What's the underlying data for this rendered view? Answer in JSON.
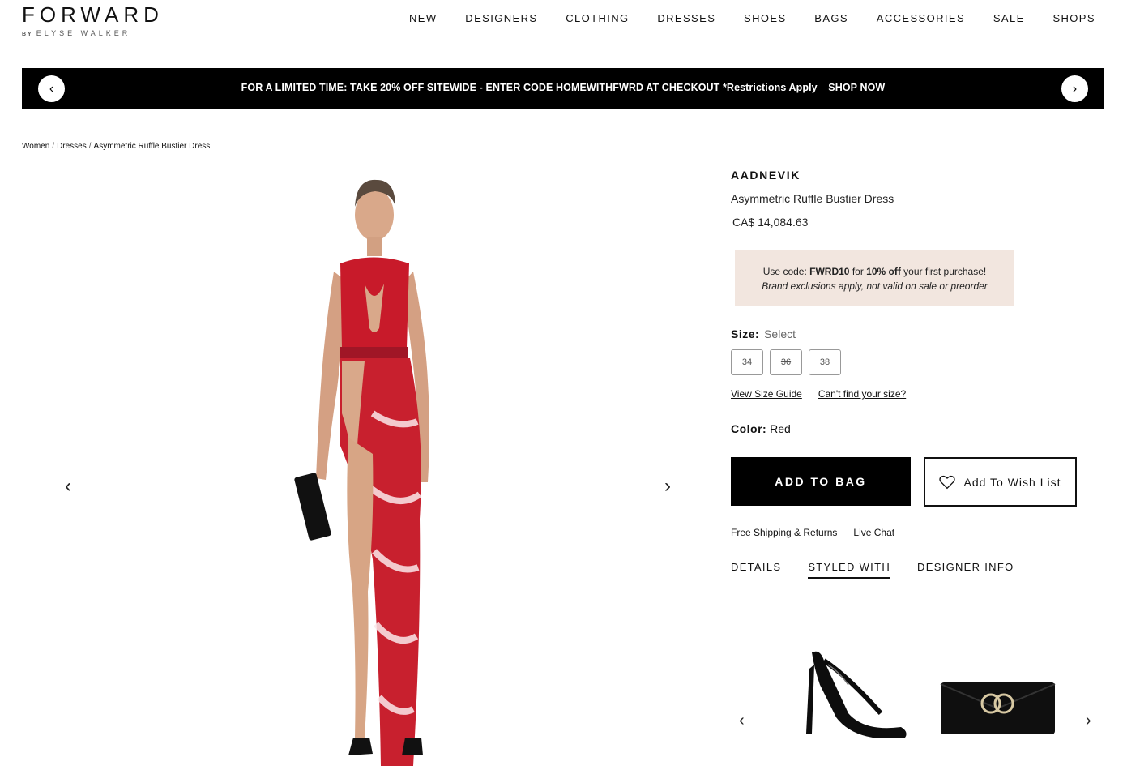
{
  "logo": {
    "main": "FORWARD",
    "by": "BY",
    "sub": "ELYSE WALKER"
  },
  "nav": [
    "NEW",
    "DESIGNERS",
    "CLOTHING",
    "DRESSES",
    "SHOES",
    "BAGS",
    "ACCESSORIES",
    "SALE",
    "SHOPS"
  ],
  "banner": {
    "text": "FOR A LIMITED TIME: TAKE 20% OFF SITEWIDE - ENTER CODE HOMEWITHFWRD AT CHECKOUT *Restrictions Apply",
    "cta": "SHOP NOW",
    "prev_icon": "chevron-left-icon",
    "next_icon": "chevron-right-icon"
  },
  "breadcrumb": [
    "Women",
    "Dresses",
    "Asymmetric Ruffle Bustier Dress"
  ],
  "gallery": {
    "prev": "‹",
    "next": "›"
  },
  "product": {
    "brand": "AADNEVIK",
    "name": "Asymmetric Ruffle Bustier Dress",
    "price": "CA$ 14,084.63"
  },
  "promo": {
    "pre": "Use code: ",
    "code": "FWRD10",
    "mid": " for ",
    "discount": "10% off",
    "post": " your first purchase!",
    "fine": "Brand exclusions apply, not valid on sale or preorder"
  },
  "size": {
    "label": "Size:",
    "value": "Select",
    "options": [
      {
        "label": "34",
        "available": true
      },
      {
        "label": "36",
        "available": false
      },
      {
        "label": "38",
        "available": true
      }
    ],
    "guide_link": "View Size Guide",
    "find_link": "Can't find your size?"
  },
  "color": {
    "label": "Color:",
    "value": "Red",
    "accent": "#c8102e"
  },
  "actions": {
    "add_to_bag": "ADD TO BAG",
    "wishlist": "Add To Wish List",
    "wishlist_icon": "heart-icon"
  },
  "service_links": [
    "Free Shipping & Returns",
    "Live Chat"
  ],
  "tabs": [
    {
      "label": "DETAILS",
      "active": false
    },
    {
      "label": "STYLED WITH",
      "active": true
    },
    {
      "label": "DESIGNER INFO",
      "active": false
    }
  ],
  "styled_with": {
    "items": [
      "sandal-icon",
      "clutch-bag-icon"
    ],
    "prev": "‹",
    "next": "›"
  }
}
